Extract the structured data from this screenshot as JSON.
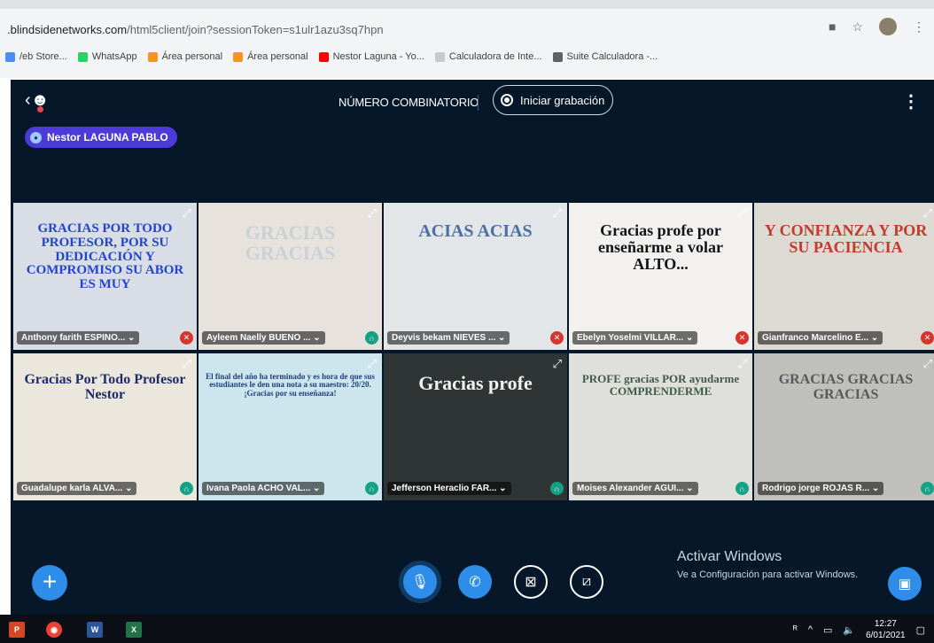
{
  "browser": {
    "url_host": ".blindsidenetworks.com",
    "url_path": "/html5client/join?sessionToken=s1ulr1azu3sq7hpn",
    "bookmarks": [
      {
        "label": "/eb Store...",
        "icon": "chrome-web-store-icon",
        "color": "#4a8df5"
      },
      {
        "label": "WhatsApp",
        "icon": "whatsapp-icon",
        "color": "#25d366"
      },
      {
        "label": "Área personal",
        "icon": "moodle-icon",
        "color": "#f7941d"
      },
      {
        "label": "Área personal",
        "icon": "moodle-icon",
        "color": "#f7941d"
      },
      {
        "label": "Nestor Laguna - Yo...",
        "icon": "youtube-icon",
        "color": "#ff0000"
      },
      {
        "label": "Calculadora de Inte...",
        "icon": "calculator-icon",
        "color": "#c9c9c9"
      },
      {
        "label": "Suite Calculadora -...",
        "icon": "suite-icon",
        "color": "#5f6368"
      }
    ]
  },
  "meeting": {
    "title": "NÚMERO COMBINATORIO",
    "record_label": "Iniciar grabación",
    "talker": "Nestor LAGUNA PABLO"
  },
  "tiles": [
    {
      "name": "Anthony farith ESPINO...",
      "status": "muted",
      "bg": "#d9dde6",
      "color": "#2345c9",
      "size": 15,
      "text": "GRACIAS POR TODO PROFESOR, POR SU DEDICACIÓN Y COMPROMISO SU ABOR ES MUY"
    },
    {
      "name": "Ayleem Naelly BUENO ...",
      "status": "listen",
      "bg": "#e7e3dc",
      "color": "#c9d0d6",
      "size": 22,
      "text": "GRACIAS GRACIAS"
    },
    {
      "name": "Deyvis bekam NIEVES ...",
      "status": "muted",
      "bg": "#e3e6e8",
      "color": "#4b6fa5",
      "size": 20,
      "text": "ACIAS ACIAS"
    },
    {
      "name": "Ebelyn Yoselmi VILLAR...",
      "status": "muted",
      "bg": "#f2f1ee",
      "color": "#101318",
      "size": 18,
      "text": "Gracias profe por enseñarme a volar ALTO..."
    },
    {
      "name": "Gianfranco Marcelino E...",
      "status": "muted",
      "bg": "#dcdad3",
      "color": "#c23a2c",
      "size": 18,
      "text": "Y CONFIANZA Y POR SU PACIENCIA"
    },
    {
      "name": "Guadalupe karla ALVA...",
      "status": "listen",
      "bg": "#ebe7dd",
      "color": "#1f2a6a",
      "size": 16,
      "text": "Gracias Por Todo Profesor Nestor"
    },
    {
      "name": "Ivana Paola ACHO VAL...",
      "status": "listen",
      "bg": "#cde6ee",
      "color": "#1d3e78",
      "size": 9,
      "text": "El final del año ha terminado y es hora de que sus estudiantes le den una nota a su maestro: 20/20. ¡Gracias por su enseñanza!"
    },
    {
      "name": "Jefferson Heraclio FAR...",
      "status": "listen",
      "bg": "#2f3534",
      "color": "#f1f2ee",
      "size": 22,
      "text": "Gracias profe"
    },
    {
      "name": "Moises Alexander AGUI...",
      "status": "listen",
      "bg": "#dfe0dc",
      "color": "#3e5b48",
      "size": 13,
      "text": "PROFE gracias POR ayudarme COMPRENDERME"
    },
    {
      "name": "Rodrigo jorge ROJAS R...",
      "status": "listen",
      "bg": "#bfbfbb",
      "color": "#565a5c",
      "size": 16,
      "text": "GRACIAS GRACIAS GRACIAS"
    }
  ],
  "watermark": {
    "title": "Activar Windows",
    "subtitle": "Ve a Configuración para activar Windows."
  },
  "taskbar": {
    "time": "12:27",
    "date": "6/01/2021"
  }
}
